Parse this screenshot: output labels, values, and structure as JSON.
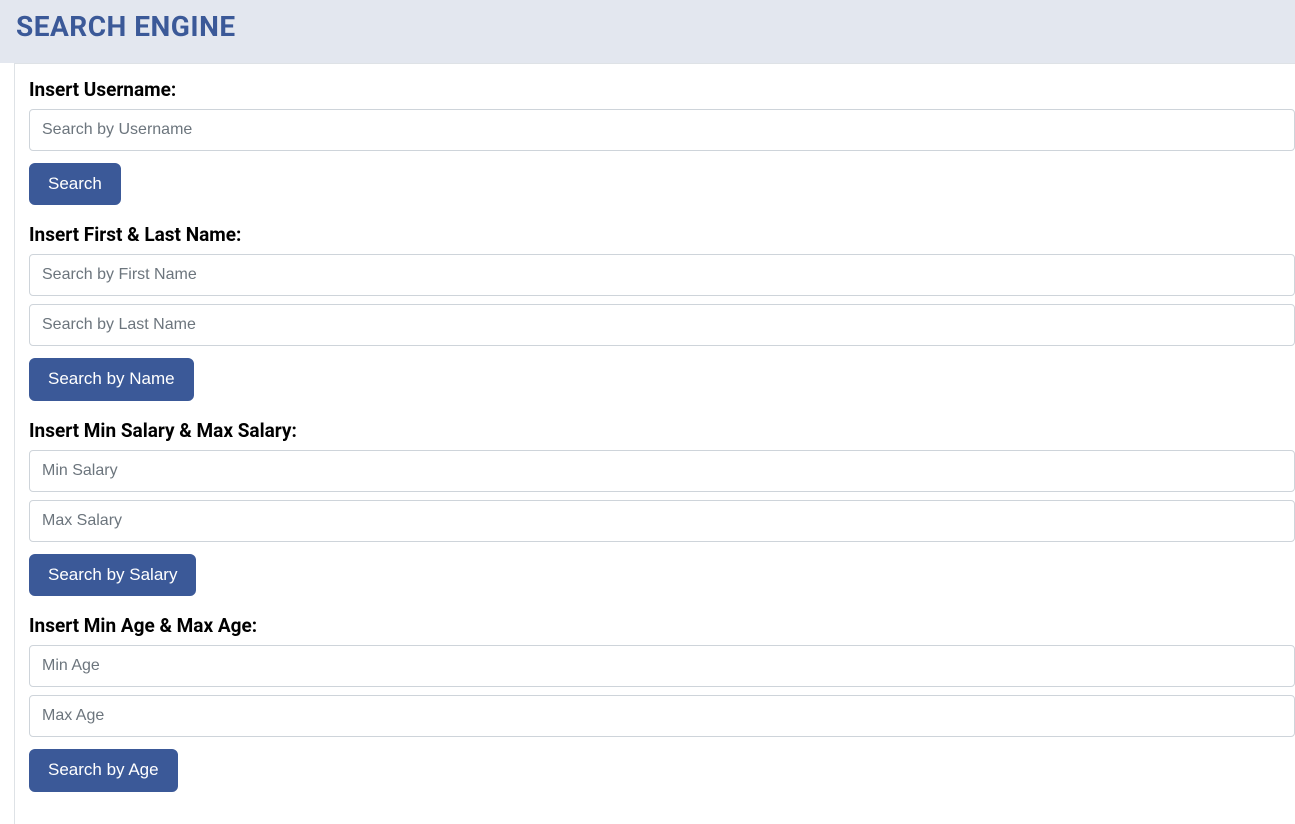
{
  "header": {
    "title": "SEARCH ENGINE"
  },
  "username_section": {
    "label": "Insert Username:",
    "placeholder": "Search by Username",
    "button": "Search"
  },
  "name_section": {
    "label": "Insert First & Last Name:",
    "first_placeholder": "Search by First Name",
    "last_placeholder": "Search by Last Name",
    "button": "Search by Name"
  },
  "salary_section": {
    "label": "Insert Min Salary & Max Salary:",
    "min_placeholder": "Min Salary",
    "max_placeholder": "Max Salary",
    "button": "Search by Salary"
  },
  "age_section": {
    "label": "Insert Min Age & Max Age:",
    "min_placeholder": "Min Age",
    "max_placeholder": "Max Age",
    "button": "Search by Age"
  }
}
